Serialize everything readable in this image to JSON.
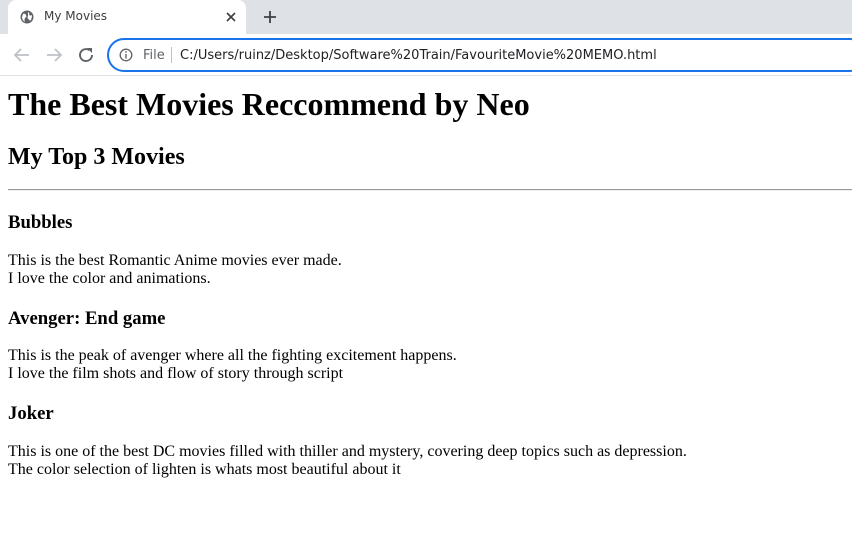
{
  "browser": {
    "tab": {
      "title": "My Movies",
      "favicon_icon": "globe-icon",
      "close_icon": "close-icon"
    },
    "new_tab_icon": "plus-icon",
    "nav": {
      "back_icon": "arrow-left-icon",
      "forward_icon": "arrow-right-icon",
      "reload_icon": "reload-icon"
    },
    "omnibox": {
      "info_icon": "info-icon",
      "scheme_label": "File",
      "url": "C:/Users/ruinz/Desktop/Software%20Train/FavouriteMovie%20MEMO.html"
    },
    "accent_color": "#1a73e8"
  },
  "page": {
    "heading": "The Best Movies Reccommend by Neo",
    "subheading": "My Top 3 Movies",
    "movies": [
      {
        "title": "Bubbles",
        "line1": "This is the best Romantic Anime movies ever made.",
        "line2": "I love the color and animations."
      },
      {
        "title": "Avenger: End game",
        "line1": "This is the peak of avenger where all the fighting excitement happens.",
        "line2": "I love the film shots and flow of story through script"
      },
      {
        "title": "Joker",
        "line1": "This is one of the best DC movies filled with thiller and mystery, covering deep topics such as depression.",
        "line2": "The color selection of lighten is whats most beautiful about it"
      }
    ]
  }
}
